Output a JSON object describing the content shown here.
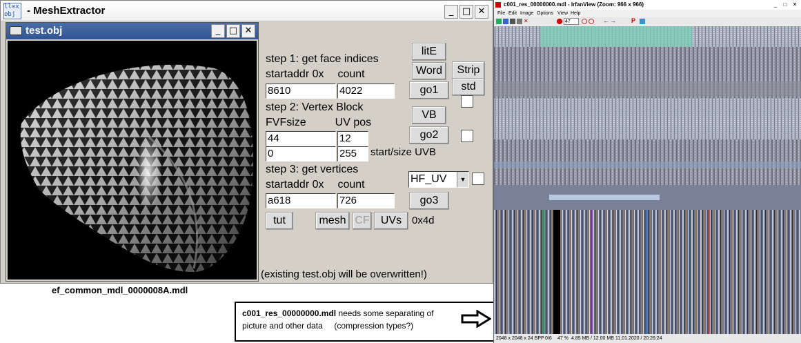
{
  "main_window": {
    "title": "MeshExtractor",
    "title_prefix": "- ",
    "icon_text": "ll∞x obj"
  },
  "child_window": {
    "title": "test.obj"
  },
  "step1": {
    "heading": "step 1: get face indices",
    "startaddr_label": "startaddr 0x",
    "count_label": "count",
    "startaddr_value": "8610",
    "count_value": "4022"
  },
  "step2": {
    "heading": "step 2: Vertex Block",
    "fvfsize_label": "FVFsize",
    "uvpos_label": "UV pos",
    "fvfsize_value": "44",
    "uvpos_value": "12",
    "start_value": "0",
    "size_value": "255",
    "startsize_label": "start/size UVB"
  },
  "step3": {
    "heading": "step 3: get vertices",
    "startaddr_label": "startaddr 0x",
    "count_label": "count",
    "startaddr_value": "a618",
    "count_value": "726",
    "dropdown_value": "HF_UV"
  },
  "buttons": {
    "lite": "litE",
    "word": "Word",
    "strip": "Strip",
    "go1": "go1",
    "std": "std",
    "vb": "VB",
    "go2": "go2",
    "go3": "go3",
    "tut": "tut",
    "mesh": "mesh",
    "cf": "CF",
    "uvs": "UVs"
  },
  "hex_label": "0x4d",
  "warning": "(existing test.obj will be overwritten!)",
  "file_label": "ef_common_mdl_0000008A.mdl",
  "note": {
    "filename": "c001_res_00000000.mdl",
    "text1": " needs some separating of",
    "text2": "picture and other data     (compression types?)"
  },
  "irfanview": {
    "title": "c001_res_00000000.mdl - IrfanView (Zoom: 966 x 966)",
    "menu": [
      "File",
      "Edit",
      "Image",
      "Options",
      "View",
      "Help"
    ],
    "zoom_value": "47",
    "status": [
      "2048 x 2048 x 24 BPP",
      "0/6",
      "47 %",
      "4.85 MB / 12.00 MB",
      "11.01.2020 / 20:26:24"
    ]
  },
  "colors": {
    "title_blue": "#2f5490",
    "dialog_gray": "#d4d0c8"
  }
}
